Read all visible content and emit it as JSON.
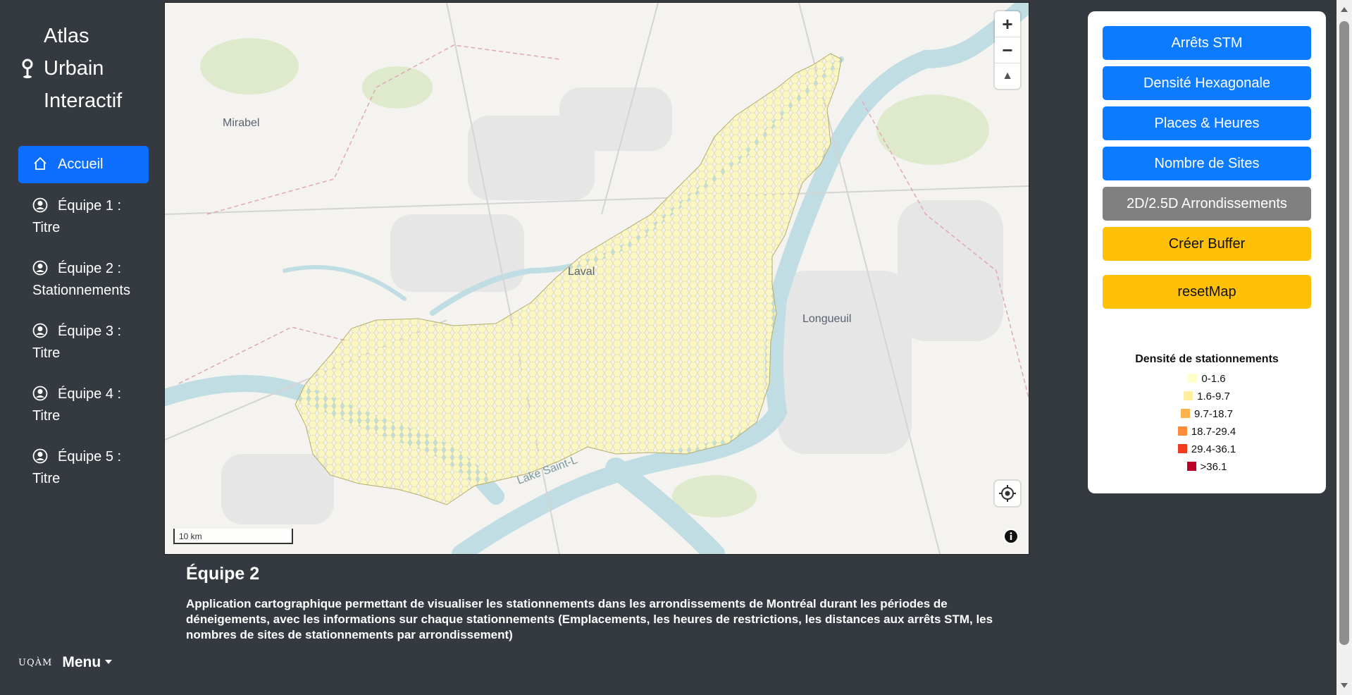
{
  "brand": {
    "title": "Atlas\nUrbain\nInteractif",
    "icon": "pin-icon"
  },
  "nav": [
    {
      "label": "Accueil",
      "icon": "home-icon",
      "active": true
    },
    {
      "label": "Équipe 1 :",
      "label2": "Titre",
      "icon": "user-circle-icon"
    },
    {
      "label": "Équipe 2 :",
      "label2": "Stationnements",
      "icon": "user-circle-icon"
    },
    {
      "label": "Équipe 3 :",
      "label2": "Titre",
      "icon": "user-circle-icon"
    },
    {
      "label": "Équipe 4 :",
      "label2": "Titre",
      "icon": "user-circle-icon"
    },
    {
      "label": "Équipe 5 :",
      "label2": "Titre",
      "icon": "user-circle-icon"
    }
  ],
  "footer": {
    "logo": "UQÀM",
    "menu": "Menu"
  },
  "map": {
    "labels": {
      "mirabel": "Mirabel",
      "laval": "Laval",
      "longueuil": "Longueuil",
      "lake": "Lake Saint-L"
    },
    "zoom_in": "+",
    "zoom_out": "−",
    "compass": "▲",
    "scale": "10 km"
  },
  "description": {
    "title": "Équipe 2",
    "body": "Application cartographique permettant de visualiser les stationnements dans les arrondissements de Montréal durant les périodes de déneigements, avec les informations sur chaque stationnements (Emplacements, les heures de restrictions, les distances aux arrêts STM, les nombres de sites de stationnements par arrondissement)"
  },
  "panel": {
    "buttons": [
      {
        "label": "Arrêts STM",
        "style": "blue"
      },
      {
        "label": "Densité Hexagonale",
        "style": "blue"
      },
      {
        "label": "Places & Heures",
        "style": "blue"
      },
      {
        "label": "Nombre de Sites",
        "style": "blue"
      },
      {
        "label": "2D/2.5D Arrondissements",
        "style": "gray"
      },
      {
        "label": "Créer Buffer",
        "style": "yellow"
      },
      {
        "label": "resetMap",
        "style": "yellow"
      }
    ],
    "legend": {
      "title": "Densité de stationnements",
      "items": [
        {
          "label": "0-1.6",
          "color": "#ffffcc"
        },
        {
          "label": "1.6-9.7",
          "color": "#ffeda0"
        },
        {
          "label": "9.7-18.7",
          "color": "#feb24c"
        },
        {
          "label": "18.7-29.4",
          "color": "#fd8d3c"
        },
        {
          "label": "29.4-36.1",
          "color": "#f03b20"
        },
        {
          "label": ">36.1",
          "color": "#bd0026"
        }
      ]
    }
  }
}
